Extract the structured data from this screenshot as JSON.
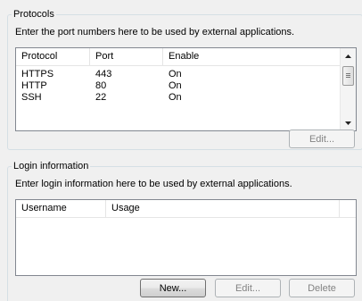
{
  "protocols": {
    "title": "Protocols",
    "description": "Enter the port numbers here to be used by external applications.",
    "columns": [
      "Protocol",
      "Port",
      "Enable"
    ],
    "rows": [
      {
        "protocol": "HTTPS",
        "port": "443",
        "enable": "On"
      },
      {
        "protocol": "HTTP",
        "port": "80",
        "enable": "On"
      },
      {
        "protocol": "SSH",
        "port": "22",
        "enable": "On"
      }
    ],
    "edit_label": "Edit..."
  },
  "login": {
    "title": "Login information",
    "description": "Enter login information here to be used by external applications.",
    "columns": [
      "Username",
      "Usage"
    ],
    "new_label": "New...",
    "edit_label": "Edit...",
    "delete_label": "Delete"
  }
}
